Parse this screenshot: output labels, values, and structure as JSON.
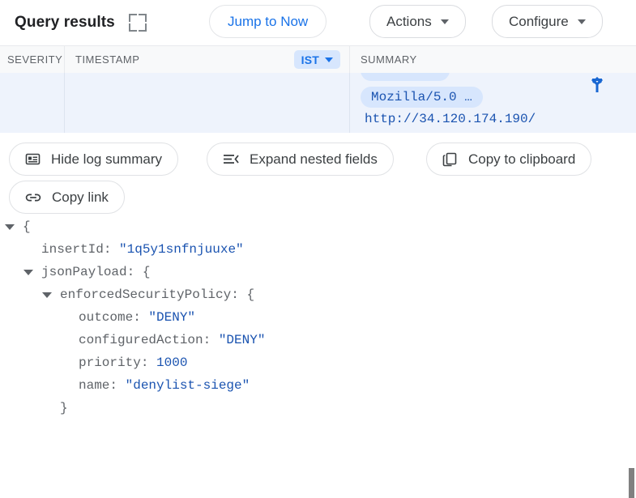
{
  "header": {
    "title": "Query results",
    "fullscreen_icon": "fullscreen-icon",
    "jump_to_now": "Jump to Now",
    "actions": "Actions",
    "configure": "Configure"
  },
  "columns": {
    "severity": "SEVERITY",
    "timestamp": "TIMESTAMP",
    "timezone": "IST",
    "summary": "SUMMARY"
  },
  "log_row": {
    "chip": "Mozilla/5.0 …",
    "url": "http://34.120.174.190/",
    "collapse_icon": "collapse-row-icon"
  },
  "action_buttons": {
    "hide_log_summary": "Hide log summary",
    "expand_nested_fields": "Expand nested fields",
    "copy_to_clipboard": "Copy to clipboard",
    "copy_link": "Copy link"
  },
  "json_tree": [
    {
      "indent": 0,
      "twisty": true,
      "text": "{"
    },
    {
      "indent": 1,
      "twisty": false,
      "key": "insertId: ",
      "value": "\"1q5y1snfnjuuxe\""
    },
    {
      "indent": 1,
      "twisty": true,
      "text": "jsonPayload: {"
    },
    {
      "indent": 2,
      "twisty": true,
      "text": "enforcedSecurityPolicy: {"
    },
    {
      "indent": 3,
      "twisty": false,
      "key": "outcome: ",
      "value": "\"DENY\""
    },
    {
      "indent": 3,
      "twisty": false,
      "key": "configuredAction: ",
      "value": "\"DENY\""
    },
    {
      "indent": 3,
      "twisty": false,
      "key": "priority: ",
      "value": "1000"
    },
    {
      "indent": 3,
      "twisty": false,
      "key": "name: ",
      "value": "\"denylist-siege\""
    },
    {
      "indent": 2,
      "twisty": false,
      "text": "}"
    }
  ],
  "colors": {
    "accent_blue": "#1a73e8",
    "value_blue": "#1a53b0",
    "chip_bg": "#d7e6fd",
    "row_selected_bg": "#eef3fc",
    "header_bg": "#f8f9fa",
    "text_grey": "#5f6368",
    "scrollbar_thumb": "#808080"
  }
}
